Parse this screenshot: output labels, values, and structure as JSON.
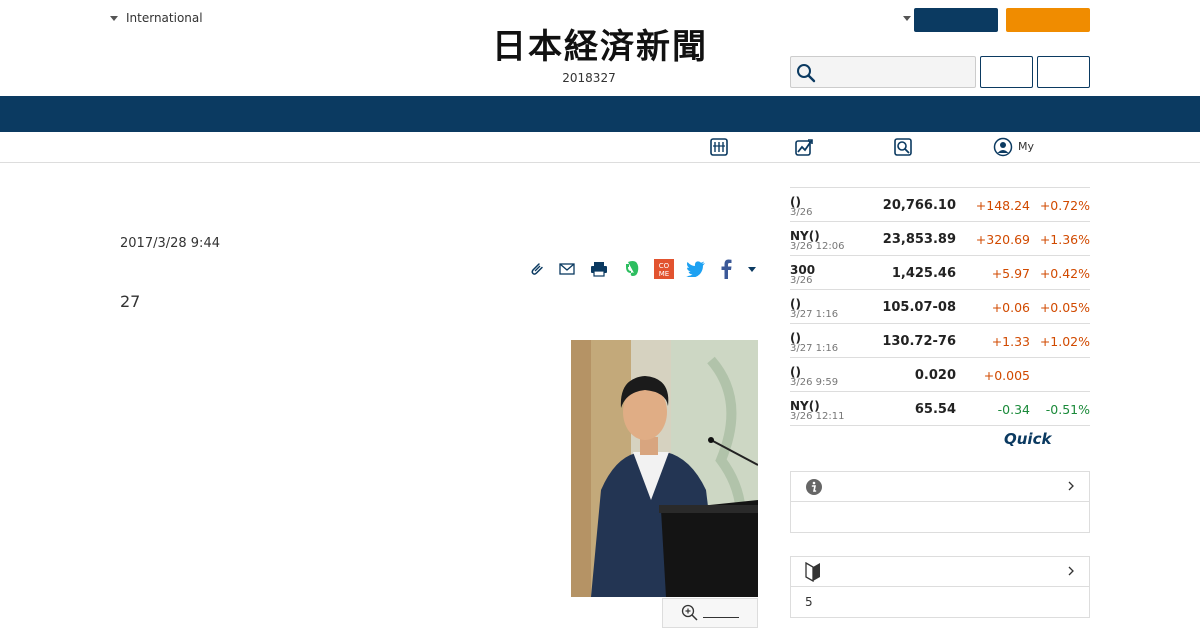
{
  "header": {
    "edition_label": "International",
    "logo_text": "日本経済新聞",
    "date_text": "2018327",
    "my_label": "My"
  },
  "article": {
    "timestamp": "2017/3/28 9:44",
    "lead_text": "27"
  },
  "markets": [
    {
      "name": "()",
      "time": "3/26",
      "value": "20,766.10",
      "change": "+148.24",
      "pct": "+0.72%",
      "dir": "up"
    },
    {
      "name": "NY()",
      "time": "3/26 12:06",
      "value": "23,853.89",
      "change": "+320.69",
      "pct": "+1.36%",
      "dir": "up"
    },
    {
      "name": "300",
      "time": "3/26",
      "value": "1,425.46",
      "change": "+5.97",
      "pct": "+0.42%",
      "dir": "up"
    },
    {
      "name": "()",
      "time": "3/27 1:16",
      "value": "105.07-08",
      "change": "+0.06",
      "pct": "+0.05%",
      "dir": "up"
    },
    {
      "name": "()",
      "time": "3/27 1:16",
      "value": "130.72-76",
      "change": "+1.33",
      "pct": "+1.02%",
      "dir": "up"
    },
    {
      "name": "()",
      "time": "3/26 9:59",
      "value": "0.020",
      "change": "+0.005",
      "pct": "",
      "dir": "up"
    },
    {
      "name": "NY()",
      "time": "3/26 12:11",
      "value": "65.54",
      "change": "-0.34",
      "pct": "-0.51%",
      "dir": "down"
    }
  ],
  "quick_logo": "Quick",
  "box_two": {
    "body_text": "5"
  },
  "colors": {
    "navy": "#0b3a61",
    "orange": "#f08c00",
    "up": "#d14a00",
    "down": "#1b8a3a"
  },
  "icons": {
    "search": "search-icon",
    "nav": [
      "table-icon",
      "chart-icon",
      "magnifier-doc-icon",
      "user-circle-icon"
    ],
    "share": [
      "clip-icon",
      "mail-icon",
      "print-icon",
      "evernote-icon",
      "come-icon",
      "twitter-icon",
      "facebook-icon",
      "caret-down-icon"
    ],
    "info": "info-icon",
    "beginner": "beginner-mark-icon"
  }
}
